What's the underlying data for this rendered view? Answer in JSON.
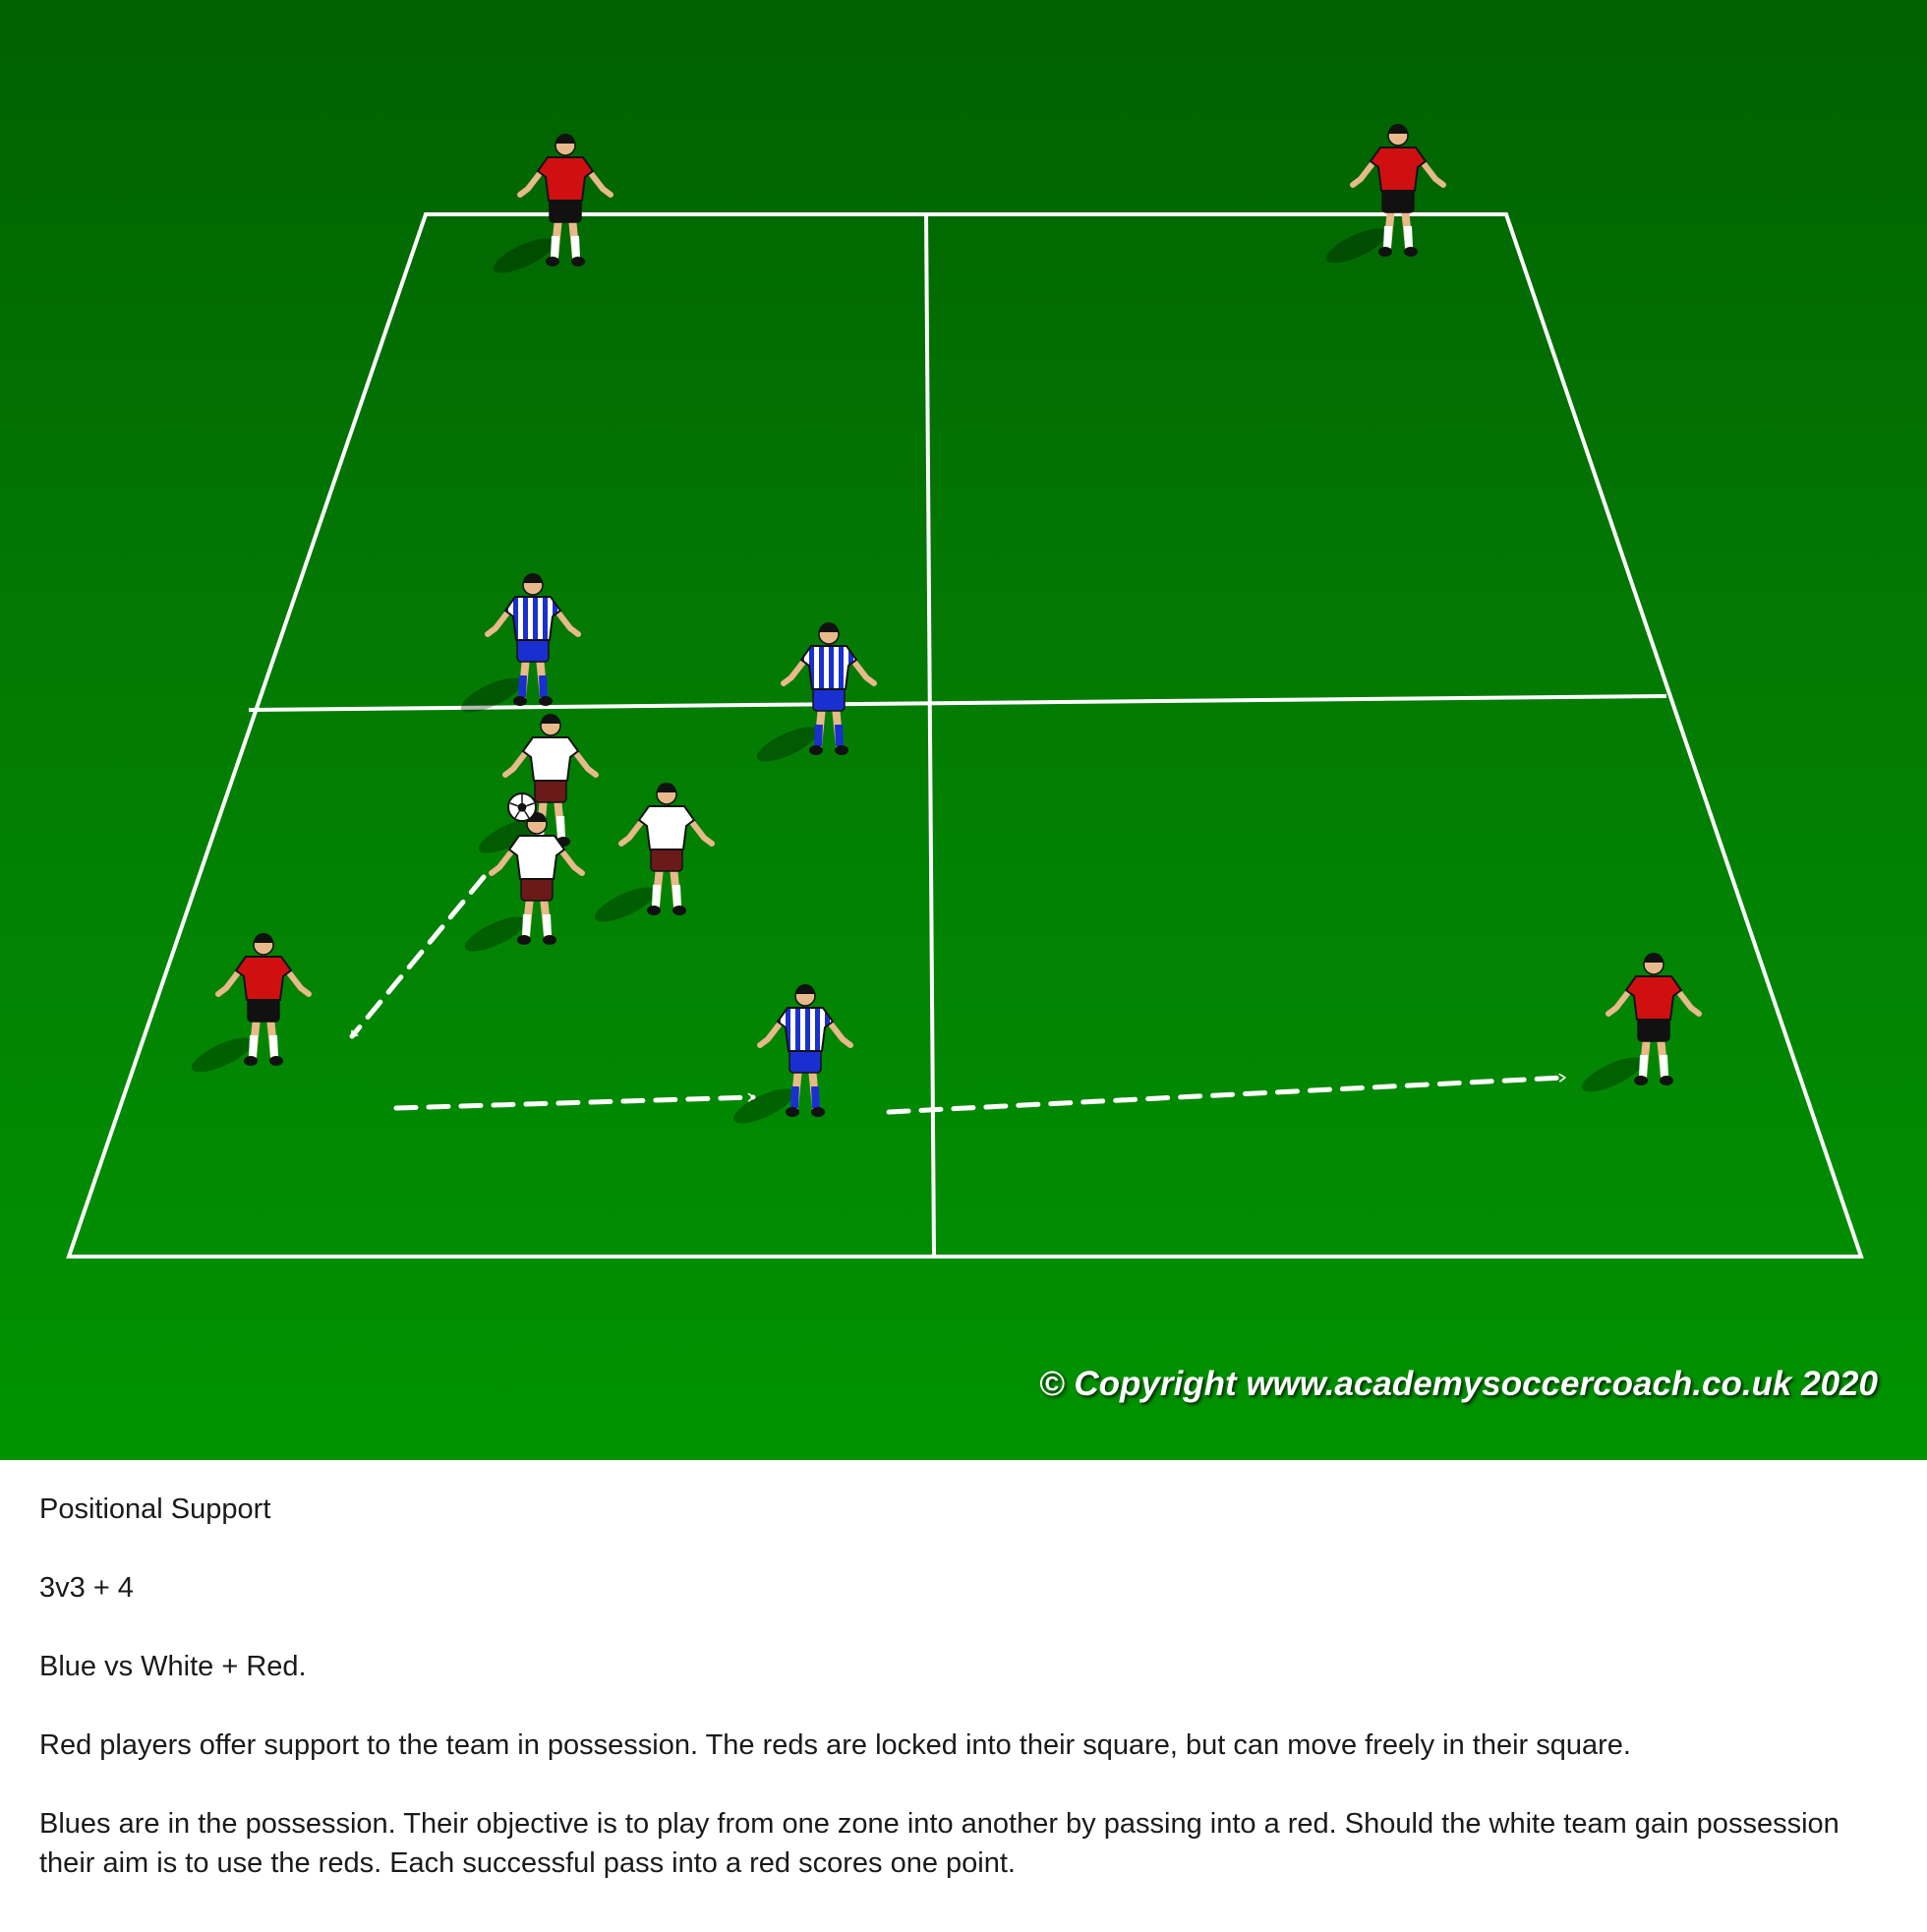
{
  "diagram": {
    "copyright": "© Copyright www.academysoccercoach.co.uk 2020",
    "colors": {
      "red_shirt": "#d01010",
      "red_shorts": "#111111",
      "blue_stripe": "#1a2fd0",
      "blue_shorts": "#1a2fd0",
      "white_shirt": "#ffffff",
      "white_shorts": "#6b1a1a",
      "pitch_line": "#ffffff"
    },
    "players": [
      {
        "team": "red"
      },
      {
        "team": "red"
      },
      {
        "team": "red"
      },
      {
        "team": "red"
      },
      {
        "team": "blue"
      },
      {
        "team": "blue"
      },
      {
        "team": "blue"
      },
      {
        "team": "white"
      },
      {
        "team": "white"
      },
      {
        "team": "white"
      }
    ],
    "ball": {
      "icon": "soccer-ball-icon"
    }
  },
  "description": {
    "title": "Positional Support",
    "format": "3v3 + 4",
    "teams": "Blue vs White + Red.",
    "paragraph1": "Red players offer support to the team in possession. The reds are locked into their square, but can move freely in their square.",
    "paragraph2": "Blues are in the possession. Their objective is to play from one zone into another by passing into a red. Should the white team gain possession their aim is to use the reds. Each successful pass into a red scores one point."
  }
}
